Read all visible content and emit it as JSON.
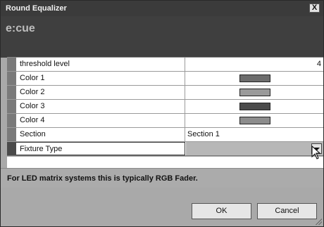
{
  "window": {
    "title": "Round Equalizer",
    "close_glyph": "X"
  },
  "logo": {
    "text": "e:cue"
  },
  "properties": [
    {
      "label": "threshold level",
      "value": "4"
    },
    {
      "label": "Color 1",
      "swatch": "#6c6c6c"
    },
    {
      "label": "Color 2",
      "swatch": "#9a9a9a"
    },
    {
      "label": "Color 3",
      "swatch": "#4a4a4a"
    },
    {
      "label": "Color 4",
      "swatch": "#8c8c8c"
    },
    {
      "label": "Section",
      "value": "Section 1"
    },
    {
      "label": "Fixture Type",
      "value": ""
    }
  ],
  "info": {
    "text": "For LED matrix systems this is typically RGB Fader."
  },
  "buttons": {
    "ok": "OK",
    "cancel": "Cancel"
  },
  "icons": {
    "close": "close-icon",
    "dropdown": "chevron-down-icon",
    "cursor": "mouse-pointer-icon",
    "grip": "resize-grip-icon"
  }
}
